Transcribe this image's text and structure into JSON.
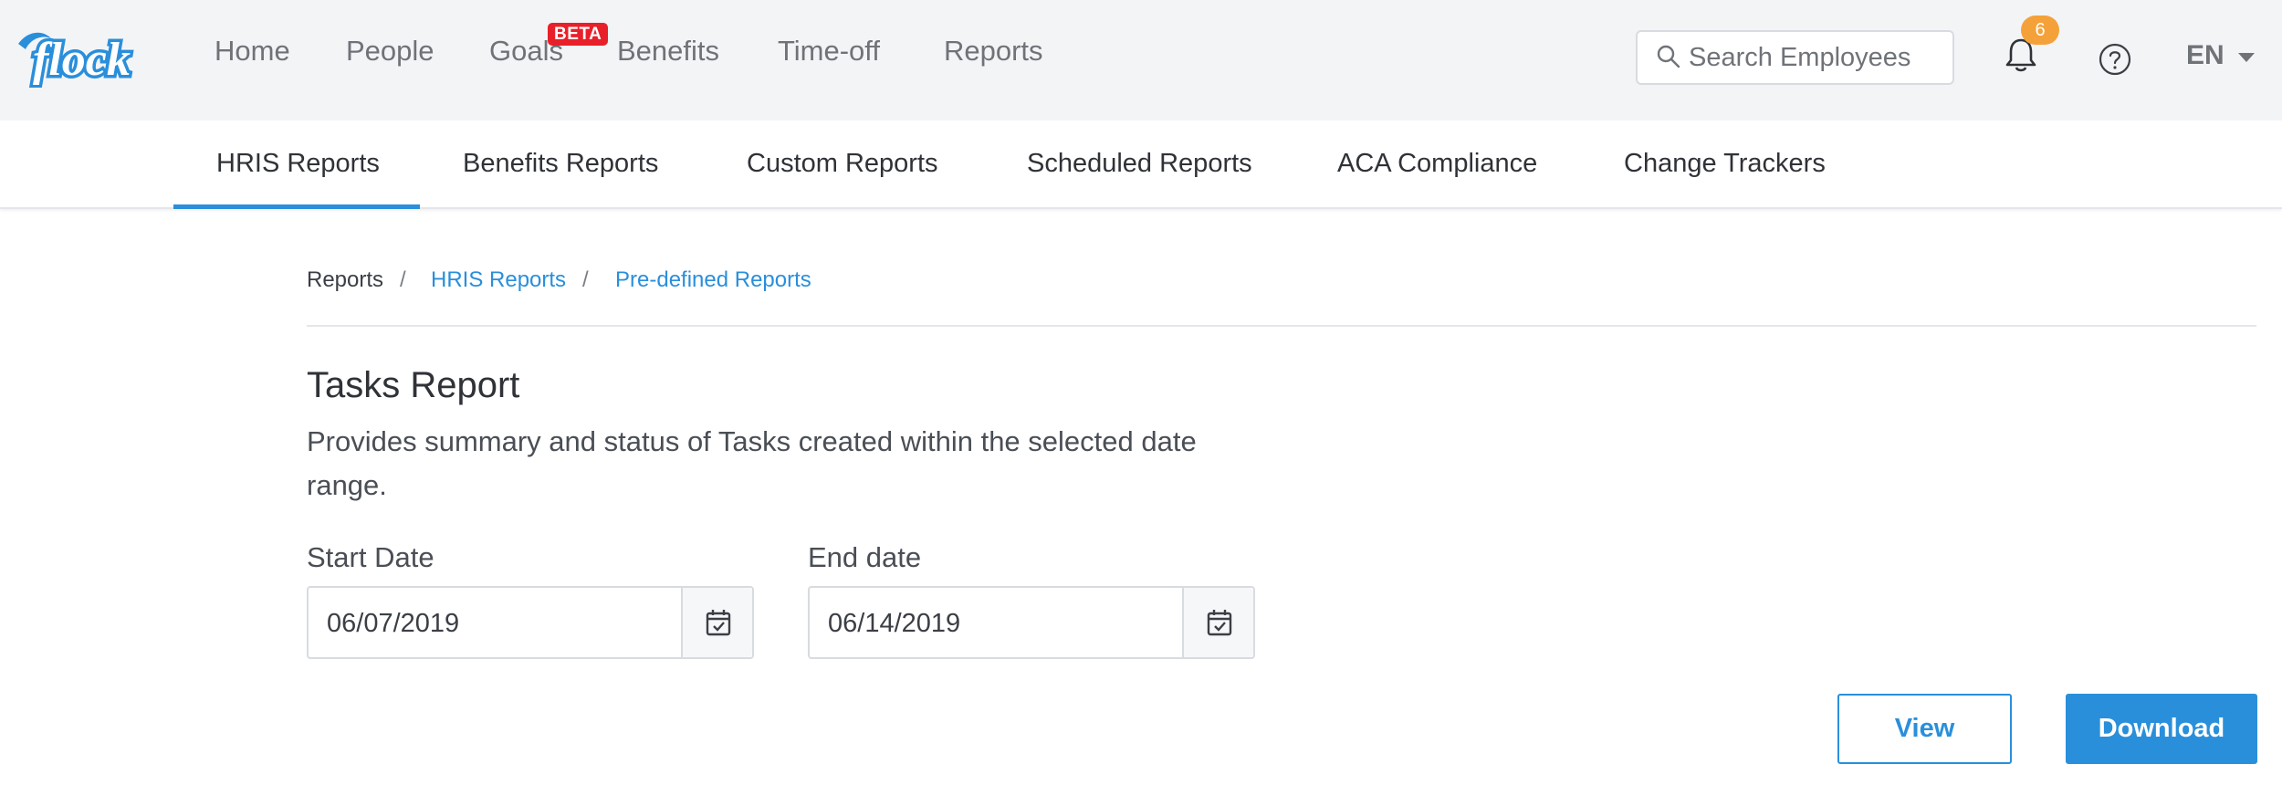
{
  "brand": {
    "name": "flock",
    "color": "#2a8fdb"
  },
  "nav": {
    "items": [
      "Home",
      "People",
      "Goals",
      "Benefits",
      "Time-off",
      "Reports"
    ],
    "beta_badge": "BETA"
  },
  "search": {
    "placeholder": "Search Employees",
    "icon": "search-icon"
  },
  "notifications": {
    "count": "6",
    "icon": "bell-icon"
  },
  "help": {
    "icon": "question-circle-icon"
  },
  "language": {
    "selected": "EN"
  },
  "subtabs": {
    "items": [
      "HRIS Reports",
      "Benefits Reports",
      "Custom Reports",
      "Scheduled Reports",
      "ACA Compliance",
      "Change Trackers"
    ],
    "active": "HRIS Reports"
  },
  "breadcrumb": {
    "items": [
      "Reports",
      "HRIS Reports",
      "Pre-defined Reports"
    ],
    "separator": "/"
  },
  "report": {
    "title": "Tasks Report",
    "description": "Provides summary and status of Tasks created within the selected date range."
  },
  "form": {
    "start_label": "Start Date",
    "start_value": "06/07/2019",
    "end_label": "End date",
    "end_value": "06/14/2019"
  },
  "actions": {
    "view_label": "View",
    "download_label": "Download"
  },
  "colors": {
    "accent": "#2a8fdb",
    "badge": "#e8202a",
    "notification": "#f5a13a",
    "topbar_bg": "#f3f4f6"
  }
}
